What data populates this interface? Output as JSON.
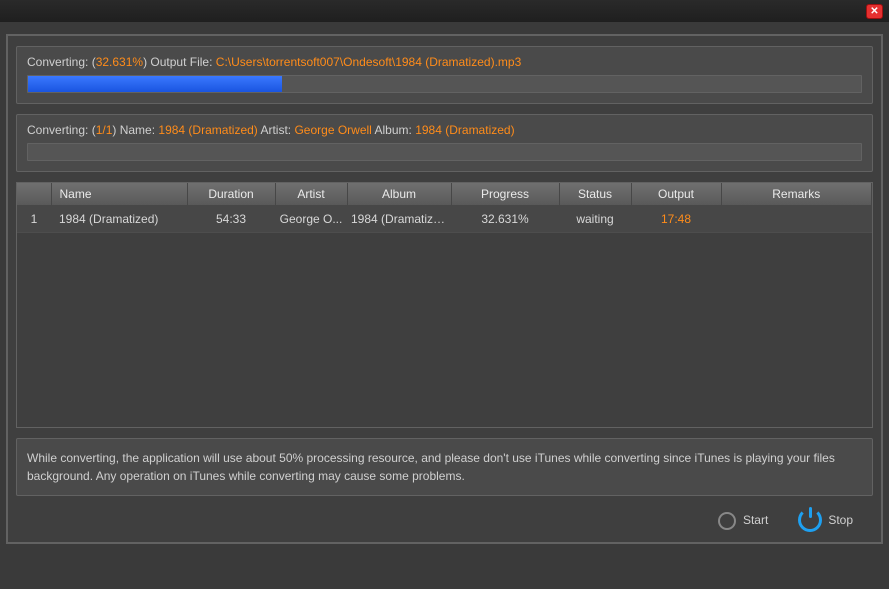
{
  "progress1": {
    "label_prefix": "Converting: (",
    "percent": "32.631%",
    "label_mid": ") Output File: ",
    "output_file": "C:\\Users\\torrentsoft007\\Ondesoft\\1984 (Dramatized).mp3",
    "fill_percent": 30.5
  },
  "progress2": {
    "label_prefix": "Converting: (",
    "count": "1/1",
    "label_name": ") Name: ",
    "name": "1984 (Dramatized)",
    "label_artist": " Artist: ",
    "artist": "George Orwell",
    "label_album": " Album: ",
    "album": "1984 (Dramatized)",
    "fill_percent": 0
  },
  "table": {
    "headers": {
      "idx": "",
      "name": "Name",
      "duration": "Duration",
      "artist": "Artist",
      "album": "Album",
      "progress": "Progress",
      "status": "Status",
      "output": "Output",
      "remarks": "Remarks"
    },
    "rows": [
      {
        "idx": "1",
        "name": "1984 (Dramatized)",
        "duration": "54:33",
        "artist": "George O...",
        "album": "1984 (Dramatize...",
        "progress": "32.631%",
        "status": "waiting",
        "output": "17:48",
        "remarks": ""
      }
    ]
  },
  "note": "While converting, the application will use about 50% processing resource, and please don't use iTunes while converting since iTunes is playing your files background. Any operation on iTunes while converting may cause some problems.",
  "footer": {
    "start": "Start",
    "stop": "Stop"
  }
}
